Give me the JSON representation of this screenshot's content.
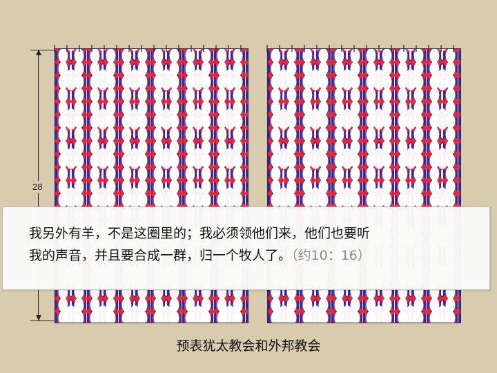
{
  "figure": {
    "dimension_label": "28"
  },
  "quote": {
    "line1": "我另外有羊，不是这圈里的；我必须领他们来，他们也要听",
    "line2": "我的声音，并且要合成一群，归一个牧人了。",
    "reference": "（约10：16）"
  },
  "caption": "预表犹太教会和外邦教会",
  "colors": {
    "background": "#d8cbae",
    "curtain_red": "#e8263a",
    "curtain_blue": "#2a2a8c",
    "curtain_purple": "#7a4bb0"
  }
}
